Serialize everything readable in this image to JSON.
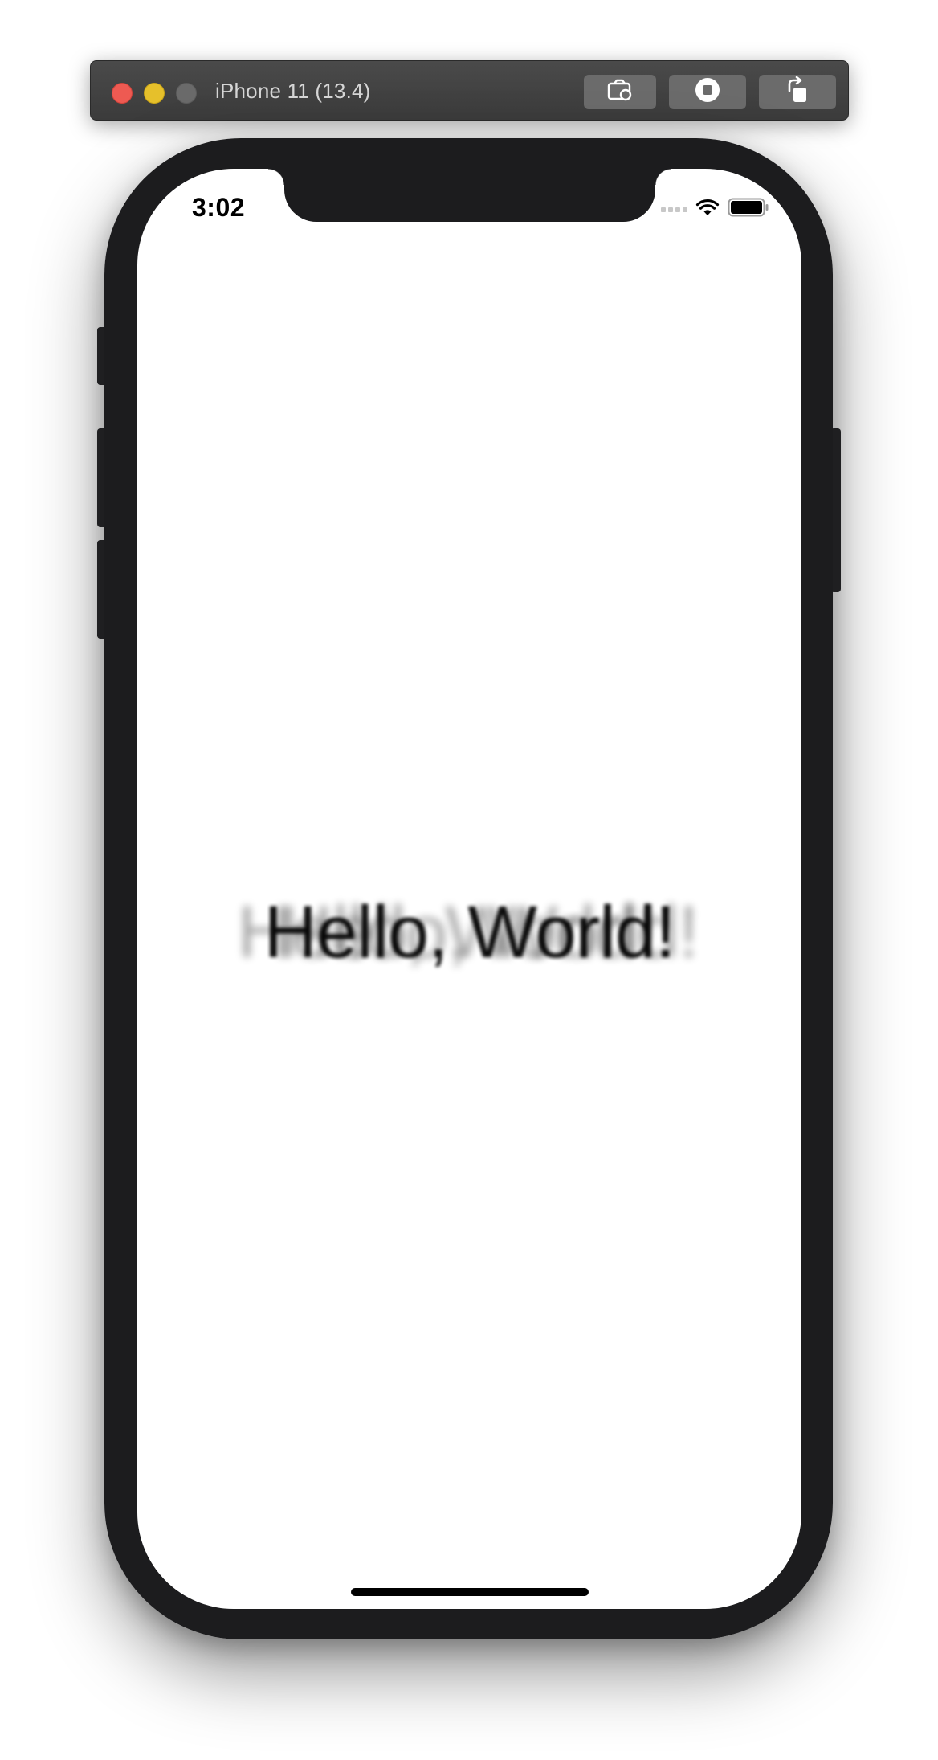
{
  "simulator": {
    "title": "iPhone 11 (13.4)",
    "buttons": {
      "screenshot_icon": "camera-icon",
      "home_icon": "home-icon",
      "rotate_icon": "rotate-icon"
    }
  },
  "status_bar": {
    "time": "3:02",
    "signal_icon": "cellular-signal-icon",
    "wifi_icon": "wifi-icon",
    "battery_icon": "battery-icon"
  },
  "content": {
    "greeting": "Hello, World!"
  },
  "colors": {
    "close": "#ee5a52",
    "minimize": "#e6c02b",
    "zoom": "#6a6a6a",
    "frame": "#1c1c1e",
    "titlebar": "#3b3b3b"
  }
}
